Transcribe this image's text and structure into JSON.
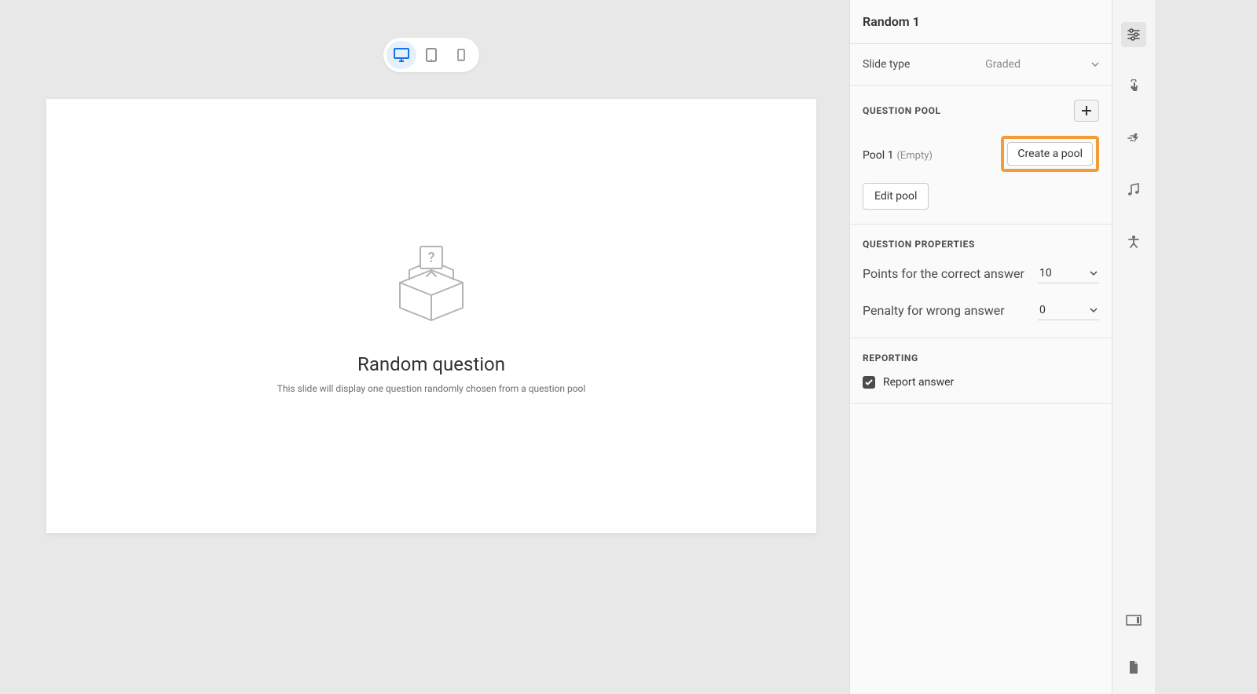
{
  "canvas": {
    "title": "Random question",
    "subtitle": "This slide will display one question randomly chosen from a question pool"
  },
  "panel": {
    "title": "Random 1",
    "slideType": {
      "label": "Slide type",
      "value": "Graded"
    },
    "questionPool": {
      "header": "QUESTION POOL",
      "poolName": "Pool 1",
      "poolStatus": "(Empty)",
      "createBtn": "Create a pool",
      "editBtn": "Edit pool"
    },
    "questionProperties": {
      "header": "QUESTION PROPERTIES",
      "pointsLabel": "Points for the correct answer",
      "pointsValue": "10",
      "penaltyLabel": "Penalty for wrong answer",
      "penaltyValue": "0"
    },
    "reporting": {
      "header": "REPORTING",
      "reportLabel": "Report answer",
      "reportChecked": true
    }
  }
}
